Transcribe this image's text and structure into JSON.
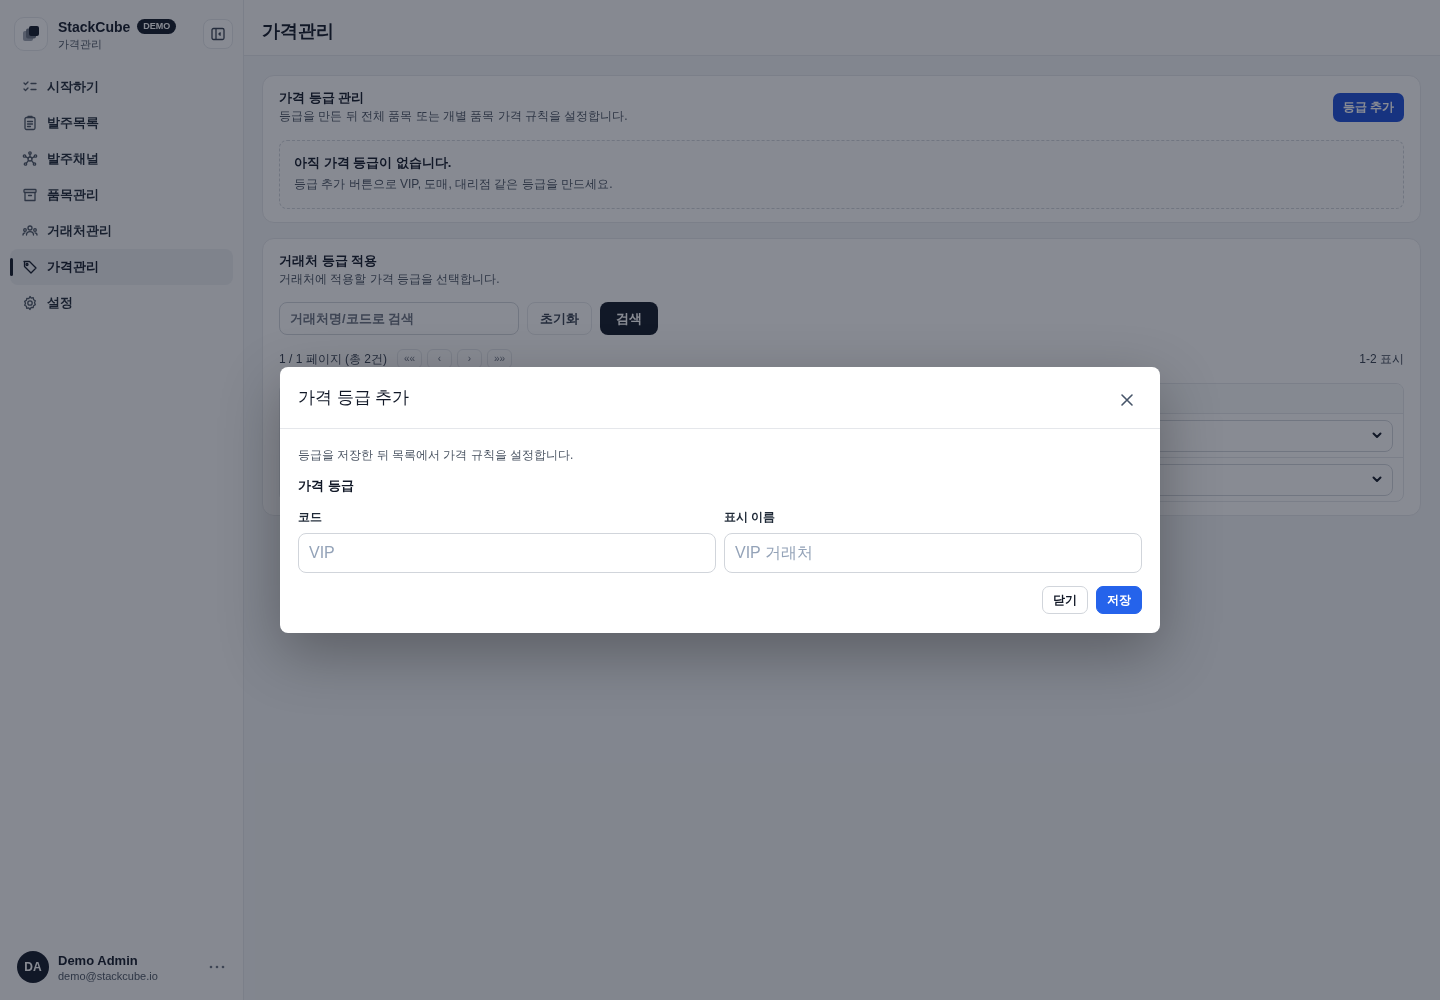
{
  "sidebar": {
    "brand": {
      "name": "StackCube",
      "badge": "DEMO",
      "subtitle": "가격관리"
    },
    "items": [
      {
        "label": "시작하기",
        "selected": false
      },
      {
        "label": "발주목록",
        "selected": false
      },
      {
        "label": "발주채널",
        "selected": false
      },
      {
        "label": "품목관리",
        "selected": false
      },
      {
        "label": "거래처관리",
        "selected": false
      },
      {
        "label": "가격관리",
        "selected": true
      },
      {
        "label": "설정",
        "selected": false
      }
    ],
    "user": {
      "initials": "DA",
      "name": "Demo Admin",
      "email": "demo@stackcube.io"
    }
  },
  "header": {
    "title": "가격관리"
  },
  "grade_card": {
    "title": "가격 등급 관리",
    "description": "등급을 만든 뒤 전체 품목 또는 개별 품목 가격 규칙을 설정합니다.",
    "add_button": "등급 추가",
    "empty_state": {
      "title": "아직 가격 등급이 없습니다.",
      "description": "등급 추가 버튼으로 VIP, 도매, 대리점 같은 등급을 만드세요."
    }
  },
  "customer_card": {
    "title": "거래처 등급 적용",
    "description": "거래처에 적용할 가격 등급을 선택합니다.",
    "search": {
      "placeholder": "거래처명/코드로 검색"
    },
    "reset_button": "초기화",
    "search_button": "검색",
    "pagination": {
      "summary": "1 / 1 페이지 (총 2건)",
      "buttons": [
        "««",
        "‹",
        "›",
        "»»"
      ],
      "range": "1-2 표시"
    },
    "table": {
      "rows": [
        {
          "cells": [
            {
              "kind": "select"
            }
          ]
        },
        {
          "cells": [
            {
              "kind": "select"
            }
          ]
        }
      ]
    }
  },
  "modal": {
    "title": "가격 등급 추가",
    "description": "등급을 저장한 뒤 목록에서 가격 규칙을 설정합니다.",
    "section": "가격 등급",
    "fields": [
      {
        "label": "코드",
        "placeholder": "VIP"
      },
      {
        "label": "표시 이름",
        "placeholder": "VIP 거래처"
      }
    ],
    "buttons": [
      {
        "label": "닫기",
        "kind": "secondary"
      },
      {
        "label": "저장",
        "kind": "primary"
      }
    ]
  }
}
